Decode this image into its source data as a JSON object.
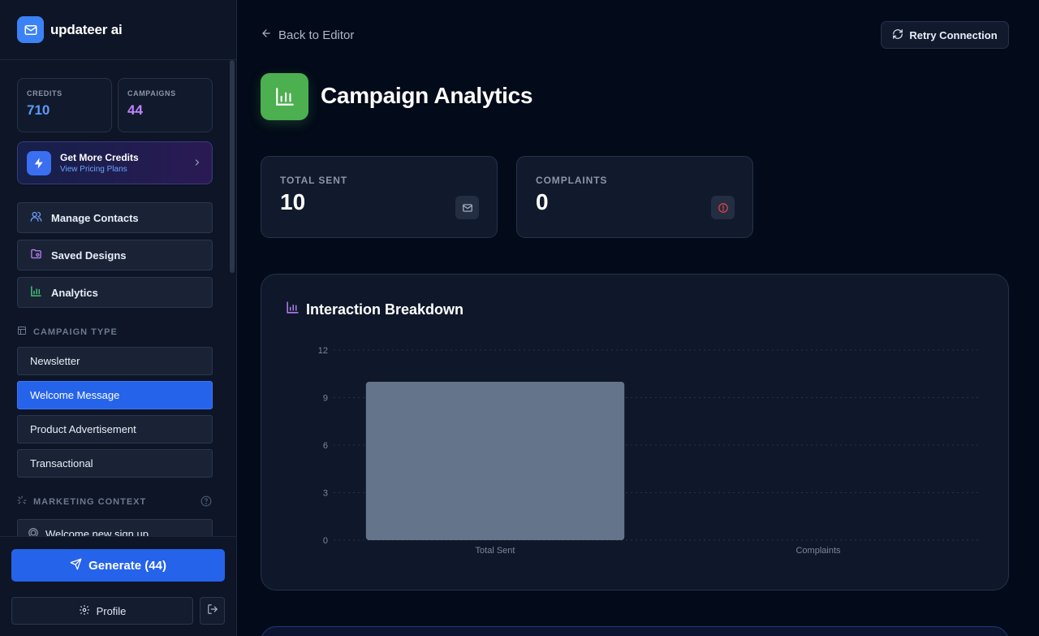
{
  "brand": {
    "name": "updateer ai"
  },
  "stats": {
    "credits": {
      "label": "CREDITS",
      "value": "710",
      "color": "#5b9bf8"
    },
    "campaigns": {
      "label": "CAMPAIGNS",
      "value": "44",
      "color": "#c084fc"
    }
  },
  "promo": {
    "title": "Get More Credits",
    "subtitle": "View Pricing Plans"
  },
  "nav": [
    {
      "label": "Manage Contacts",
      "icon": "users-icon"
    },
    {
      "label": "Saved Designs",
      "icon": "folder-heart-icon"
    },
    {
      "label": "Analytics",
      "icon": "bar-chart-icon"
    }
  ],
  "campaign_type": {
    "heading": "CAMPAIGN TYPE",
    "items": [
      "Newsletter",
      "Welcome Message",
      "Product Advertisement",
      "Transactional"
    ],
    "selected": "Welcome Message"
  },
  "marketing_context": {
    "heading": "MARKETING CONTEXT",
    "item": "Welcome new sign up"
  },
  "footer": {
    "generate_label": "Generate (44)",
    "profile_label": "Profile"
  },
  "main": {
    "back_label": "Back to Editor",
    "retry_label": "Retry Connection",
    "title": "Campaign Analytics",
    "metrics": [
      {
        "label": "TOTAL SENT",
        "value": "10",
        "icon": "mail-check-icon"
      },
      {
        "label": "COMPLAINTS",
        "value": "0",
        "icon": "alert-circle-icon"
      }
    ],
    "chart_title": "Interaction Breakdown"
  },
  "colors": {
    "accent": "#2563eb",
    "success": "#4caf50",
    "bar": "#64748b",
    "danger": "#ef4444"
  },
  "chart_data": {
    "type": "bar",
    "title": "Interaction Breakdown",
    "categories": [
      "Total Sent",
      "Complaints"
    ],
    "values": [
      10,
      0
    ],
    "ylim": [
      0,
      12
    ],
    "yticks": [
      0,
      3,
      6,
      9,
      12
    ],
    "grid": true
  }
}
